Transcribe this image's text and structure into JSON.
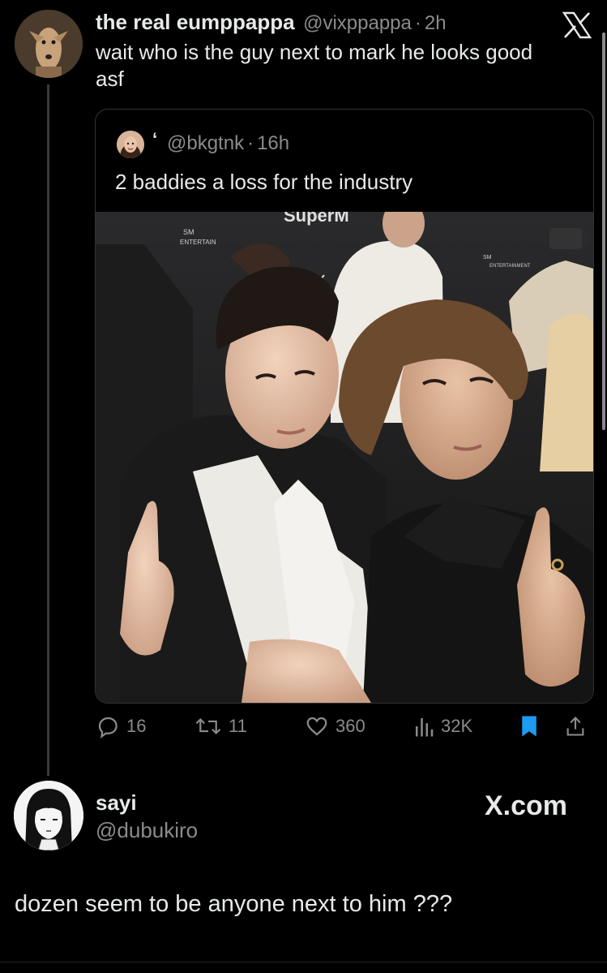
{
  "tweet": {
    "display_name": "the real eumppappa",
    "handle": "@vixppappa",
    "separator": "·",
    "time": "2h",
    "text_line1": "wait who is the guy next to mark he looks good",
    "text_line2": "asf",
    "platform_icon": "x-logo-icon"
  },
  "quote": {
    "badge": "‘",
    "handle": "@bkgtnk",
    "separator": "·",
    "time": "16h",
    "text": "2 baddies a loss for the industry",
    "photo_signs": {
      "sm_label": "SM",
      "entertainment_label": "ENTERTAIN",
      "superm_label": "SuperM",
      "sm_label_right": "SM",
      "entertainment_label_right": "ENTERTAINMENT"
    }
  },
  "actions": {
    "replies": "16",
    "retweets": "11",
    "likes": "360",
    "views": "32K",
    "icons": [
      "reply-icon",
      "retweet-icon",
      "heart-icon",
      "views-icon",
      "bookmark-icon",
      "share-icon"
    ],
    "bookmark_color": "#1d9bf0"
  },
  "reply": {
    "display_name": "sayi",
    "handle": "@dubukiro",
    "site_label": "X.com",
    "text": "dozen seem to be anyone next to him ???"
  },
  "colors": {
    "background": "#000000",
    "text": "#e7e9ea",
    "muted": "#8b8b8b",
    "accent": "#1d9bf0"
  }
}
